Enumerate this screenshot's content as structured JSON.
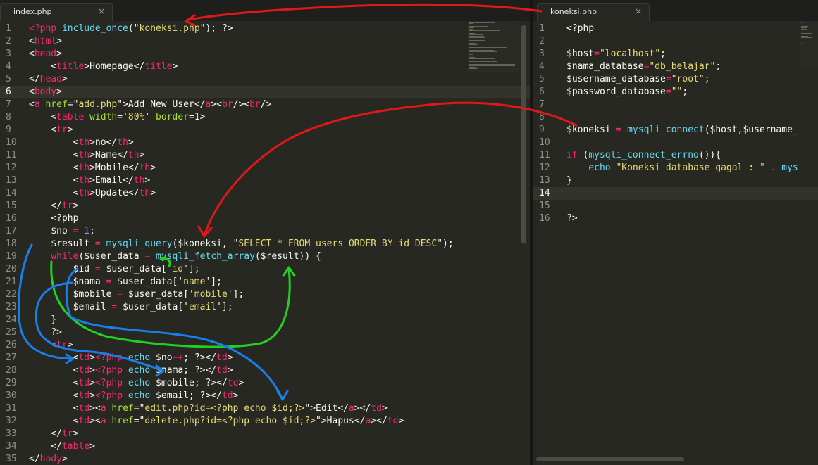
{
  "left_tab": {
    "label": "index.php",
    "close_glyph": "×"
  },
  "right_tab": {
    "label": "koneksi.php",
    "close_glyph": "×"
  },
  "left_editor": {
    "current_line": 6,
    "lines": [
      [
        [
          "t-tag",
          "<?php"
        ],
        [
          "t-kw",
          " include_once"
        ],
        [
          "",
          "(\""
        ],
        [
          "t-str",
          "koneksi.php"
        ],
        [
          "",
          "\"); ?>"
        ]
      ],
      [
        [
          "",
          "<"
        ],
        [
          "t-tag",
          "html"
        ],
        [
          "",
          ">"
        ]
      ],
      [
        [
          "",
          "<"
        ],
        [
          "t-tag",
          "head"
        ],
        [
          "",
          ">"
        ]
      ],
      [
        [
          "",
          "    <"
        ],
        [
          "t-tag",
          "title"
        ],
        [
          "",
          ">Homepage</"
        ],
        [
          "t-tag",
          "title"
        ],
        [
          "",
          ">"
        ]
      ],
      [
        [
          "",
          "</"
        ],
        [
          "t-tag",
          "head"
        ],
        [
          "",
          ">"
        ]
      ],
      [
        [
          "",
          "<"
        ],
        [
          "t-tag",
          "body"
        ],
        [
          "",
          ">"
        ]
      ],
      [
        [
          "",
          "<"
        ],
        [
          "t-tag",
          "a"
        ],
        [
          "t-attr",
          " href"
        ],
        [
          "",
          "=\""
        ],
        [
          "t-str",
          "add.php"
        ],
        [
          "",
          "\">Add New User</"
        ],
        [
          "t-tag",
          "a"
        ],
        [
          "",
          "><"
        ],
        [
          "t-tag",
          "br"
        ],
        [
          "",
          "/><"
        ],
        [
          "t-tag",
          "br"
        ],
        [
          "",
          "/>"
        ]
      ],
      [
        [
          "",
          "    <"
        ],
        [
          "t-tag",
          "table"
        ],
        [
          "t-attr",
          " width"
        ],
        [
          "",
          "='"
        ],
        [
          "t-str",
          "80%"
        ],
        [
          "",
          "' "
        ],
        [
          "t-attr",
          "border"
        ],
        [
          "",
          "=1>"
        ]
      ],
      [
        [
          "",
          "    <"
        ],
        [
          "t-tag",
          "tr"
        ],
        [
          "",
          ">"
        ]
      ],
      [
        [
          "",
          "        <"
        ],
        [
          "t-tag",
          "th"
        ],
        [
          "",
          ">no</"
        ],
        [
          "t-tag",
          "th"
        ],
        [
          "",
          ">"
        ]
      ],
      [
        [
          "",
          "        <"
        ],
        [
          "t-tag",
          "th"
        ],
        [
          "",
          ">Name</"
        ],
        [
          "t-tag",
          "th"
        ],
        [
          "",
          ">"
        ]
      ],
      [
        [
          "",
          "        <"
        ],
        [
          "t-tag",
          "th"
        ],
        [
          "",
          ">Mobile</"
        ],
        [
          "t-tag",
          "th"
        ],
        [
          "",
          ">"
        ]
      ],
      [
        [
          "",
          "        <"
        ],
        [
          "t-tag",
          "th"
        ],
        [
          "",
          ">Email</"
        ],
        [
          "t-tag",
          "th"
        ],
        [
          "",
          ">"
        ]
      ],
      [
        [
          "",
          "        <"
        ],
        [
          "t-tag",
          "th"
        ],
        [
          "",
          ">Update</"
        ],
        [
          "t-tag",
          "th"
        ],
        [
          "",
          ">"
        ]
      ],
      [
        [
          "",
          "    </"
        ],
        [
          "t-tag",
          "tr"
        ],
        [
          "",
          ">"
        ]
      ],
      [
        [
          "",
          "    <?php"
        ]
      ],
      [
        [
          "",
          "    $no "
        ],
        [
          "t-key",
          "="
        ],
        [
          "t-num",
          " 1"
        ],
        [
          "",
          ";"
        ]
      ],
      [
        [
          "",
          "    $result "
        ],
        [
          "t-key",
          "="
        ],
        [
          "t-fn",
          " mysqli_query"
        ],
        [
          "",
          "($koneksi, \""
        ],
        [
          "t-str",
          "SELECT * FROM users ORDER BY id DESC"
        ],
        [
          "",
          "\");"
        ]
      ],
      [
        [
          "t-key",
          "    while"
        ],
        [
          "",
          "($user_data "
        ],
        [
          "t-key",
          "="
        ],
        [
          "t-fn",
          " mysqli_fetch_array"
        ],
        [
          "",
          "($result)) {"
        ]
      ],
      [
        [
          "",
          "        $id "
        ],
        [
          "t-key",
          "="
        ],
        [
          "",
          " $user_data['"
        ],
        [
          "t-str",
          "id"
        ],
        [
          "",
          "'];"
        ]
      ],
      [
        [
          "",
          "        $nama "
        ],
        [
          "t-key",
          "="
        ],
        [
          "",
          " $user_data['"
        ],
        [
          "t-str",
          "name"
        ],
        [
          "",
          "'];"
        ]
      ],
      [
        [
          "",
          "        $mobile "
        ],
        [
          "t-key",
          "="
        ],
        [
          "",
          " $user_data['"
        ],
        [
          "t-str",
          "mobile"
        ],
        [
          "",
          "'];"
        ]
      ],
      [
        [
          "",
          "        $email "
        ],
        [
          "t-key",
          "="
        ],
        [
          "",
          " $user_data['"
        ],
        [
          "t-str",
          "email"
        ],
        [
          "",
          "'];"
        ]
      ],
      [
        [
          "",
          "    }"
        ]
      ],
      [
        [
          "",
          "    ?>"
        ]
      ],
      [
        [
          "",
          "    <"
        ],
        [
          "t-tag",
          "tr"
        ],
        [
          "",
          ">"
        ]
      ],
      [
        [
          "",
          "        <"
        ],
        [
          "t-tag",
          "td"
        ],
        [
          "",
          ">"
        ],
        [
          "t-tag",
          "<?php"
        ],
        [
          "t-kw",
          " echo"
        ],
        [
          "",
          " $no"
        ],
        [
          "t-key",
          "++"
        ],
        [
          "",
          "; ?></"
        ],
        [
          "t-tag",
          "td"
        ],
        [
          "",
          ">"
        ]
      ],
      [
        [
          "",
          "        <"
        ],
        [
          "t-tag",
          "td"
        ],
        [
          "",
          ">"
        ],
        [
          "t-tag",
          "<?php"
        ],
        [
          "t-kw",
          " echo"
        ],
        [
          "",
          " $nama; ?></"
        ],
        [
          "t-tag",
          "td"
        ],
        [
          "",
          ">"
        ]
      ],
      [
        [
          "",
          "        <"
        ],
        [
          "t-tag",
          "td"
        ],
        [
          "",
          ">"
        ],
        [
          "t-tag",
          "<?php"
        ],
        [
          "t-kw",
          " echo"
        ],
        [
          "",
          " $mobile; ?></"
        ],
        [
          "t-tag",
          "td"
        ],
        [
          "",
          ">"
        ]
      ],
      [
        [
          "",
          "        <"
        ],
        [
          "t-tag",
          "td"
        ],
        [
          "",
          ">"
        ],
        [
          "t-tag",
          "<?php"
        ],
        [
          "t-kw",
          " echo"
        ],
        [
          "",
          " $email; ?></"
        ],
        [
          "t-tag",
          "td"
        ],
        [
          "",
          ">"
        ]
      ],
      [
        [
          "",
          "        <"
        ],
        [
          "t-tag",
          "td"
        ],
        [
          "",
          "><"
        ],
        [
          "t-tag",
          "a"
        ],
        [
          "t-attr",
          " href"
        ],
        [
          "",
          "=\""
        ],
        [
          "t-str",
          "edit.php?id=<?php echo $id;?>"
        ],
        [
          "",
          "\">Edit</"
        ],
        [
          "t-tag",
          "a"
        ],
        [
          "",
          "></"
        ],
        [
          "t-tag",
          "td"
        ],
        [
          "",
          ">"
        ]
      ],
      [
        [
          "",
          "        <"
        ],
        [
          "t-tag",
          "td"
        ],
        [
          "",
          "><"
        ],
        [
          "t-tag",
          "a"
        ],
        [
          "t-attr",
          " href"
        ],
        [
          "",
          "=\""
        ],
        [
          "t-str",
          "delete.php?id=<?php echo $id;?>"
        ],
        [
          "",
          "\">Hapus</"
        ],
        [
          "t-tag",
          "a"
        ],
        [
          "",
          "></"
        ],
        [
          "t-tag",
          "td"
        ],
        [
          "",
          ">"
        ]
      ],
      [
        [
          "",
          "    </"
        ],
        [
          "t-tag",
          "tr"
        ],
        [
          "",
          ">"
        ]
      ],
      [
        [
          "",
          "    </"
        ],
        [
          "t-tag",
          "table"
        ],
        [
          "",
          ">"
        ]
      ],
      [
        [
          "",
          "</"
        ],
        [
          "t-tag",
          "body"
        ],
        [
          "",
          ">"
        ]
      ]
    ]
  },
  "right_editor": {
    "current_line": 14,
    "lines": [
      [
        [
          "",
          "<?php"
        ]
      ],
      [
        [
          "",
          ""
        ]
      ],
      [
        [
          "",
          "$host"
        ],
        [
          "t-key",
          "="
        ],
        [
          "t-str",
          "\"localhost\""
        ],
        [
          "",
          ";"
        ]
      ],
      [
        [
          "",
          "$nama_database"
        ],
        [
          "t-key",
          "="
        ],
        [
          "t-str",
          "\"db_belajar\""
        ],
        [
          "",
          ";"
        ]
      ],
      [
        [
          "",
          "$username_database"
        ],
        [
          "t-key",
          "="
        ],
        [
          "t-str",
          "\"root\""
        ],
        [
          "",
          ";"
        ]
      ],
      [
        [
          "",
          "$password_database"
        ],
        [
          "t-key",
          "="
        ],
        [
          "t-str",
          "\"\""
        ],
        [
          "",
          ";"
        ]
      ],
      [
        [
          "",
          ""
        ]
      ],
      [
        [
          "",
          ""
        ]
      ],
      [
        [
          "",
          "$koneksi "
        ],
        [
          "t-key",
          "="
        ],
        [
          "t-fn",
          " mysqli_connect"
        ],
        [
          "",
          "($host,$username_"
        ]
      ],
      [
        [
          "",
          ""
        ]
      ],
      [
        [
          "t-key",
          "if"
        ],
        [
          "",
          " ("
        ],
        [
          "t-fn",
          "mysqli_connect_errno"
        ],
        [
          "",
          "()){"
        ]
      ],
      [
        [
          "t-kw",
          "    echo"
        ],
        [
          "t-str",
          " \"Koneksi database gagal : \""
        ],
        [
          "t-key",
          " ."
        ],
        [
          "t-fn",
          " mys"
        ]
      ],
      [
        [
          "",
          "}"
        ]
      ],
      [
        [
          "",
          ""
        ]
      ],
      [
        [
          "",
          ""
        ]
      ],
      [
        [
          "",
          "?>"
        ]
      ]
    ]
  }
}
